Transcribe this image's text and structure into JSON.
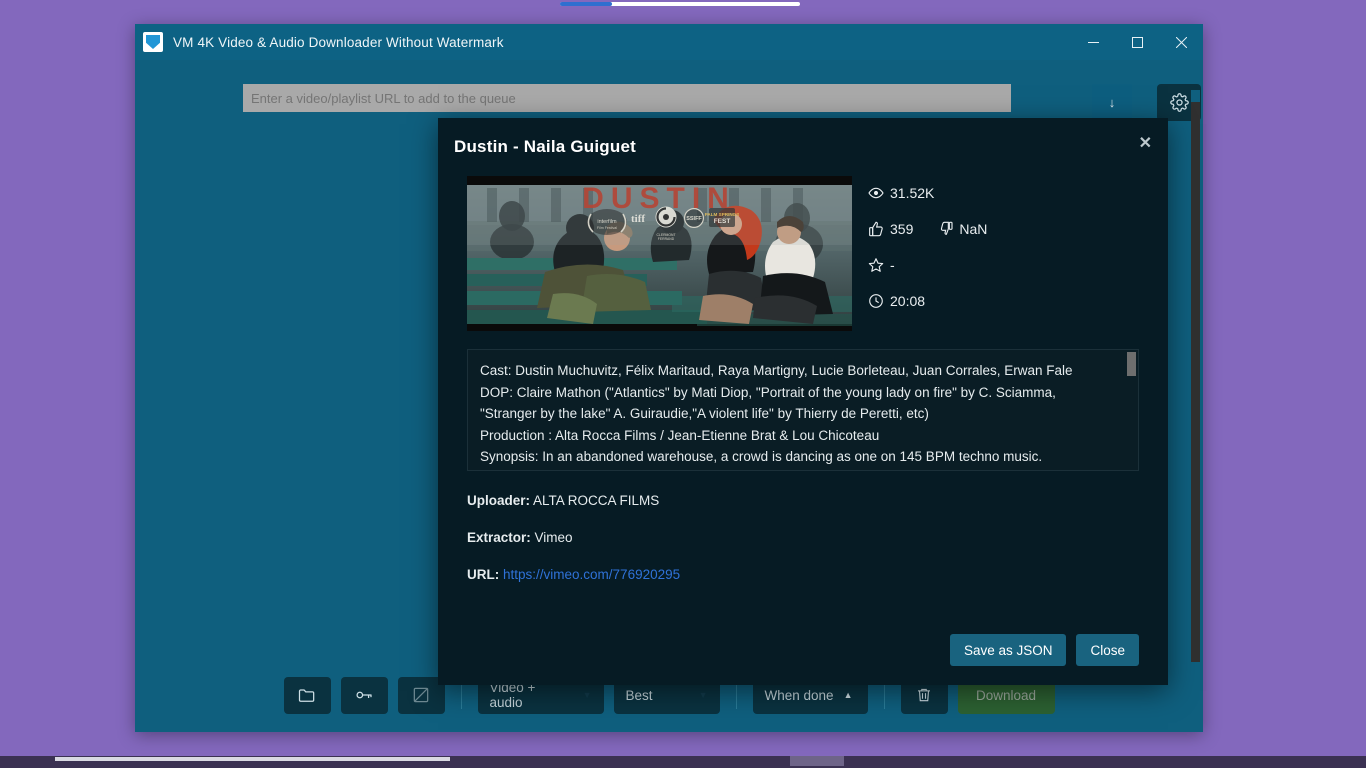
{
  "window": {
    "title": "VM 4K Video & Audio Downloader Without Watermark",
    "app_icon": "app-logo-icon",
    "controls": {
      "minimize": "minimize-icon",
      "maximize": "maximize-icon",
      "close": "close-icon"
    }
  },
  "url_bar": {
    "placeholder": "Enter a video/playlist URL to add to the queue",
    "value": "",
    "paste_label": "↓",
    "settings_icon": "gear-icon"
  },
  "toolbar": {
    "folder_icon": "folder-icon",
    "key_icon": "key-icon",
    "edit_icon": "edit-note-icon",
    "trash_icon": "trash-icon",
    "format_select": "Video + audio",
    "quality_select": "Best",
    "when_done_select": "When done",
    "download_label": "Download"
  },
  "dialog": {
    "title": "Dustin - Naila Guiguet",
    "close_label": "✕",
    "thumbnail_alt": "video-thumbnail",
    "stats": {
      "views_icon": "eye-icon",
      "views": "31.52K",
      "likes_icon": "thumbs-up-icon",
      "likes": "359",
      "dislikes_icon": "thumbs-down-icon",
      "dislikes": "NaN",
      "rating_icon": "star-icon",
      "rating": "-",
      "duration_icon": "clock-icon",
      "duration": "20:08"
    },
    "description": "Cast: Dustin Muchuvitz, Félix Maritaud, Raya Martigny, Lucie Borleteau, Juan Corrales, Erwan Fale\nDOP: Claire Mathon (\"Atlantics\" by Mati Diop, \"Portrait of the young lady on fire\" by C. Sciamma,\n\"Stranger by the lake\" A. Guiraudie,\"A violent life\" by Thierry de Peretti, etc)\nProduction : Alta Rocca Films / Jean-Etienne Brat & Lou Chicoteau\nSynopsis: In an abandoned warehouse, a crowd is dancing as one on 145 BPM techno music.",
    "uploader_label": "Uploader:",
    "uploader": "ALTA ROCCA FILMS",
    "extractor_label": "Extractor:",
    "extractor": "Vimeo",
    "url_label": "URL:",
    "url": "https://vimeo.com/776920295",
    "save_json_label": "Save as JSON",
    "close_button_label": "Close"
  },
  "colors": {
    "desktop": "#8368bd",
    "window_bg": "#0f5f7e",
    "titlebar": "#0d6284",
    "dialog_bg": "#061b24",
    "accent_button": "#19637f",
    "download_button": "#2c6132",
    "link": "#2f72d8"
  }
}
